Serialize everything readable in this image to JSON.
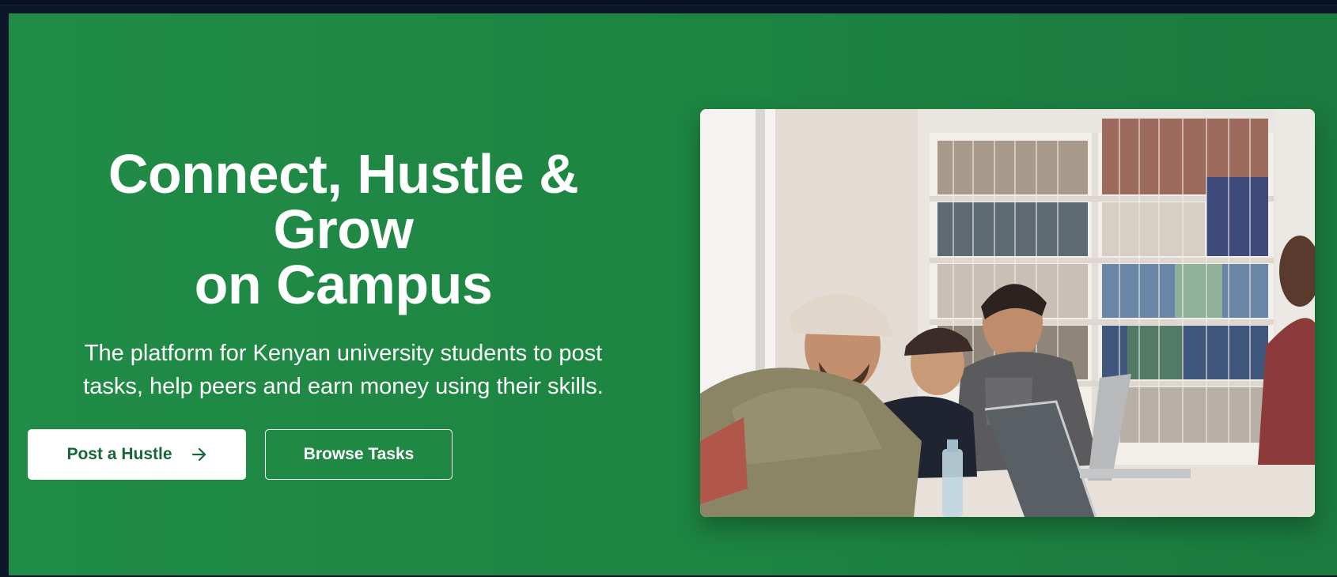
{
  "hero": {
    "title_lines": [
      "Connect, Hustle &",
      "Grow",
      "on Campus"
    ],
    "subtitle_lines": [
      "The platform for Kenyan university students to post",
      "tasks, help peers and earn money using their skills."
    ],
    "primary_button": {
      "label": "Post a Hustle",
      "icon": "arrow-right-icon"
    },
    "secondary_button": {
      "label": "Browse Tasks"
    },
    "image": {
      "subject": "students-laughing-at-laptops-in-library"
    }
  },
  "colors": {
    "hero_green": "#1d8442",
    "button_text_green": "#17663a",
    "page_dark": "#0d1628"
  }
}
